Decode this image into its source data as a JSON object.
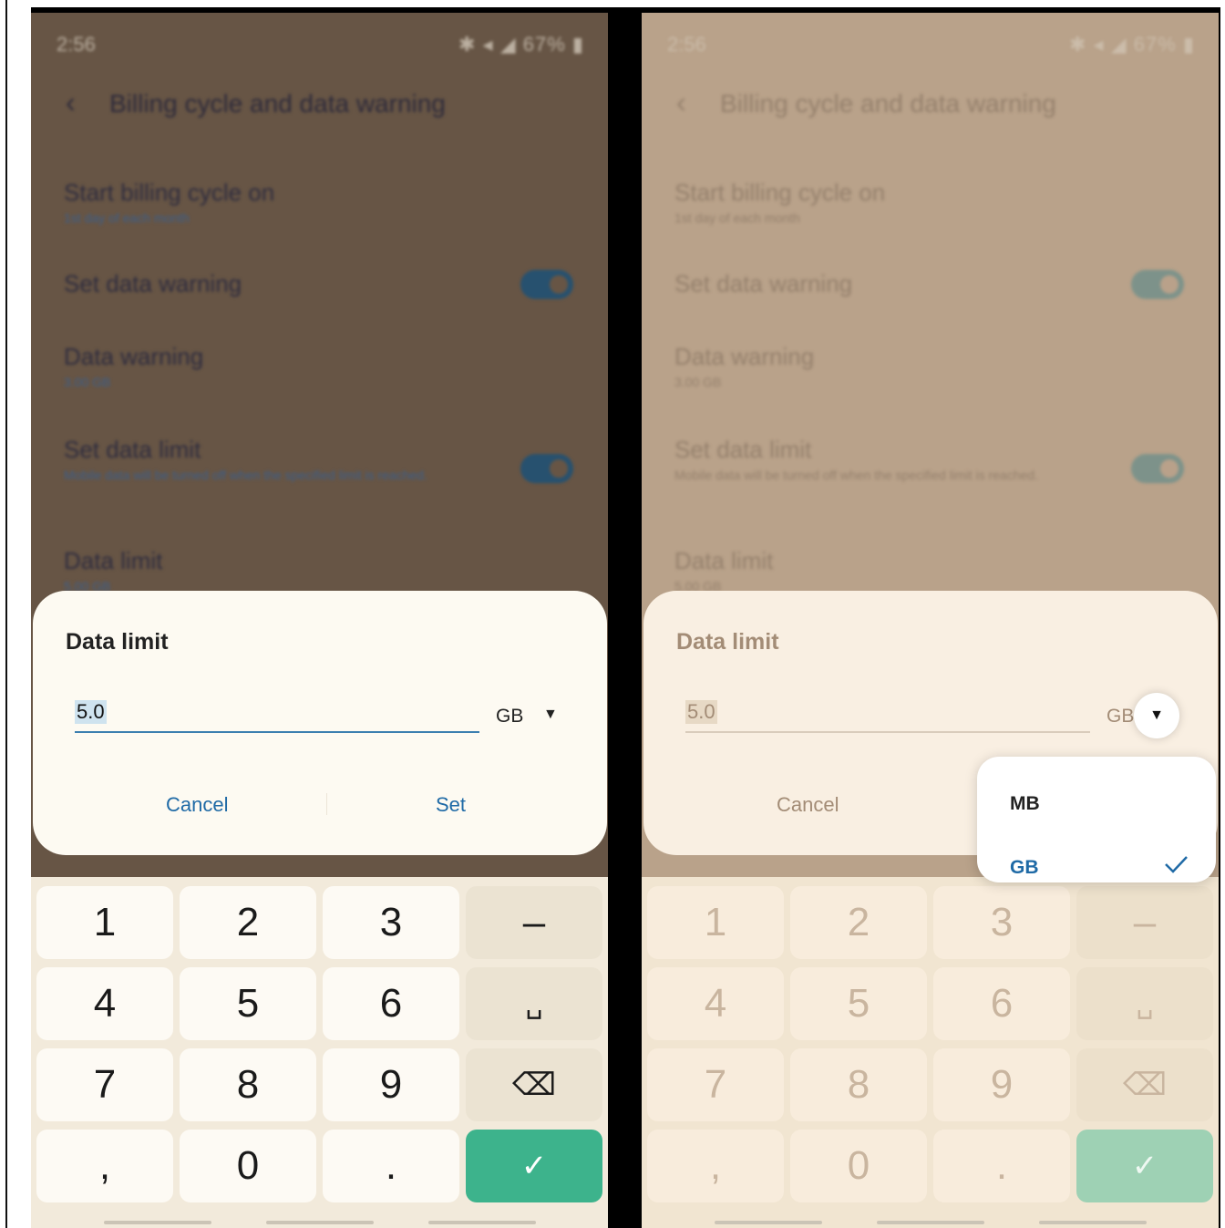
{
  "status_bar": {
    "time": "2:56",
    "icons": "✱ ◂ ◢ 67% ▮"
  },
  "header": {
    "title": "Billing cycle and data warning"
  },
  "settings": {
    "billing": {
      "label": "Start billing cycle on",
      "value": "1st day of each month"
    },
    "set_warning": {
      "label": "Set data warning",
      "on": true
    },
    "warning": {
      "label": "Data warning",
      "value": "3.00 GB"
    },
    "set_limit": {
      "label": "Set data limit",
      "desc": "Mobile data will be turned off when the specified limit is reached.",
      "on": true
    },
    "limit": {
      "label": "Data limit",
      "value": "5.00 GB"
    }
  },
  "dialog": {
    "title": "Data limit",
    "value": "5.0",
    "unit": "GB",
    "cancel": "Cancel",
    "set": "Set"
  },
  "unit_menu": {
    "options": [
      "MB",
      "GB"
    ],
    "selected": "GB"
  },
  "keyboard": {
    "rows": [
      [
        "1",
        "2",
        "3",
        "–"
      ],
      [
        "4",
        "5",
        "6",
        "␣"
      ],
      [
        "7",
        "8",
        "9",
        "⌫"
      ],
      [
        ",",
        "0",
        ".",
        "✓"
      ]
    ]
  },
  "colors": {
    "accent": "#1f6aa6",
    "confirm_key": "#3db38c",
    "overlay": "#675545"
  }
}
